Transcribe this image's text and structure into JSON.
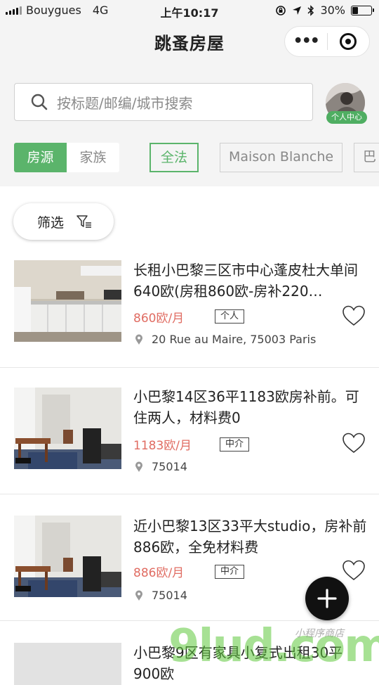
{
  "status_bar": {
    "carrier": "Bouygues",
    "network": "4G",
    "time": "上午10:17",
    "battery": "30%",
    "battery_level": 0.3
  },
  "header": {
    "title": "跳蚤房屋",
    "more_icon": "ellipsis-icon",
    "close_icon": "target-icon"
  },
  "search": {
    "placeholder": "按标题/邮编/城市搜索",
    "icon": "search-icon"
  },
  "profile": {
    "badge_label": "个人中心"
  },
  "segment": {
    "options": [
      "房源",
      "家族"
    ],
    "selected": "房源"
  },
  "chips": [
    "全法",
    "Maison Blanche",
    "巴"
  ],
  "filter": {
    "label": "筛选",
    "icon": "filter-icon"
  },
  "listings": [
    {
      "title": "长租小巴黎三区市中心蓬皮杜大单间640欧(房租860欧-房补220…",
      "price": "860欧/月",
      "tag": "个人",
      "address": "20 Rue au Maire, 75003 Paris"
    },
    {
      "title": "小巴黎14区36平1183欧房补前。可住两人，材料费0",
      "price": "1183欧/月",
      "tag": "中介",
      "address": "75014"
    },
    {
      "title": "近小巴黎13区33平大studio，房补前886欧，全免材料费",
      "price": "886欧/月",
      "tag": "中介",
      "address": "75014"
    },
    {
      "title": "小巴黎9区有家具小复式出租30平900欧",
      "price": "",
      "tag": "",
      "address": ""
    }
  ],
  "fab": {
    "icon": "plus-icon"
  },
  "watermark": {
    "text": "9lud.com",
    "sub": "小程序商店"
  },
  "colors": {
    "accent": "#5bb46b",
    "price": "#e06c62",
    "top_background": "#f4f4f4"
  }
}
